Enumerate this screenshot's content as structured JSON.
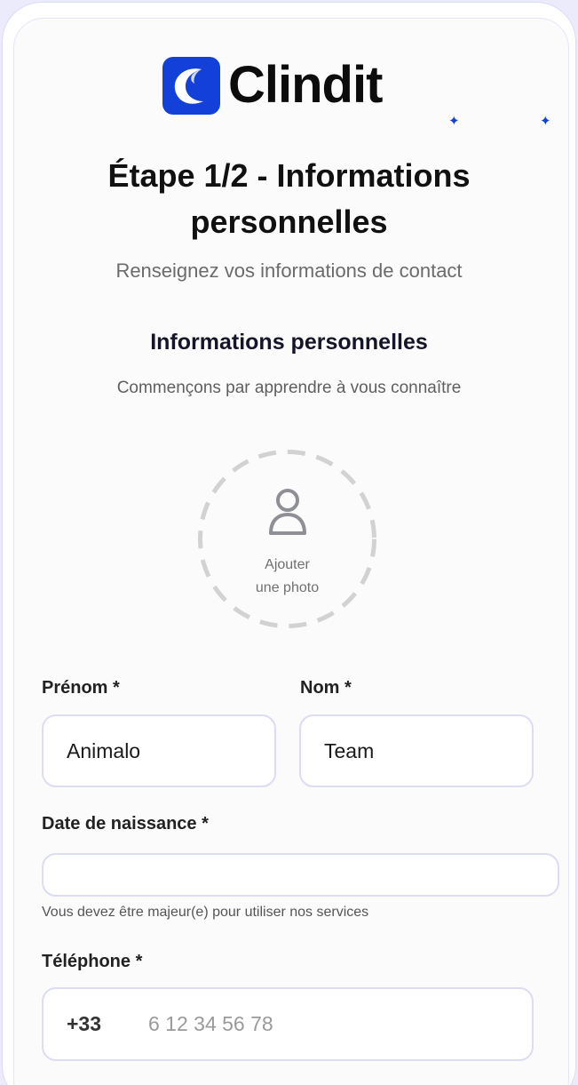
{
  "brand": {
    "name": "Clindit",
    "accent": "#1240d8"
  },
  "header": {
    "title": "Étape 1/2 - Informations personnelles",
    "subtitle": "Renseignez vos informations de contact"
  },
  "section": {
    "title": "Informations personnelles",
    "subtitle": "Commençons par apprendre à vous connaître"
  },
  "photo_upload": {
    "label_line1": "Ajouter",
    "label_line2": "une photo",
    "icon": "user-icon"
  },
  "form": {
    "first_name": {
      "label": "Prénom *",
      "value": "Animalo"
    },
    "last_name": {
      "label": "Nom *",
      "value": "Team"
    },
    "birth_date": {
      "label": "Date de naissance *",
      "value": "",
      "hint": "Vous devez être majeur(e) pour utiliser nos services"
    },
    "phone": {
      "label": "Téléphone *",
      "prefix": "+33",
      "placeholder": "6 12 34 56 78"
    }
  }
}
